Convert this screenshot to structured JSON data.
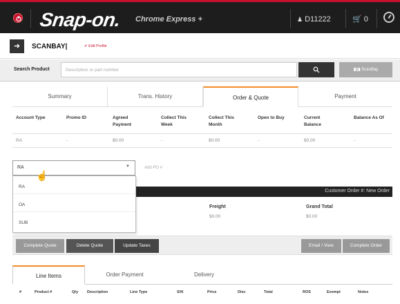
{
  "header": {
    "logo": "Snap-on.",
    "app_name": "Chrome Express +",
    "account_id": "D11222",
    "cart_count": "0"
  },
  "customer": {
    "name": "SCANBAY|",
    "edit_profile": "✔ Edit Profile"
  },
  "search": {
    "label": "Search Product",
    "placeholder": "Description or part number",
    "scan_label": "ScanBay"
  },
  "tabs": [
    {
      "label": "Summary"
    },
    {
      "label": "Trans. History"
    },
    {
      "label": "Order & Quote"
    },
    {
      "label": "Payment"
    }
  ],
  "account_table": {
    "headers": [
      "Account Type",
      "Promo ID",
      "Agreed Payment",
      "Collect This Week",
      "Collect This Month",
      "Open to Buy",
      "Current Balance",
      "Balance As Of"
    ],
    "values": [
      "RA",
      "-",
      "$0.00",
      "-",
      "$0.00",
      "-",
      "$0.00",
      "-"
    ]
  },
  "account_dropdown": {
    "selected": "RA",
    "options": [
      "RA",
      "OA",
      "SUB"
    ]
  },
  "add_po": "Add PO #",
  "customer_order": "Customer Order #: New Order",
  "totals": {
    "freight_label": "Freight",
    "freight_value": "$0.00",
    "grand_total_label": "Grand Total",
    "grand_total_value": "$0.00"
  },
  "actions": {
    "complete_quote": "Complete Quote",
    "delete_quote": "Delete Quote",
    "update_taxes": "Update Taxes",
    "email_view": "Email / View",
    "complete_order": "Complete Order"
  },
  "subtabs": [
    {
      "label": "Line Items"
    },
    {
      "label": "Order Payment"
    },
    {
      "label": "Delivery"
    }
  ],
  "line_columns": [
    "#",
    "Product #",
    "Qty",
    "Description",
    "Line Type",
    "S/N",
    "Price",
    "Disc",
    "Total",
    "ROS",
    "Exempt",
    "Notes"
  ],
  "colors": {
    "brand_red": "#c8102e",
    "accent_orange": "#f28c28",
    "dark": "#1d1d1d"
  }
}
